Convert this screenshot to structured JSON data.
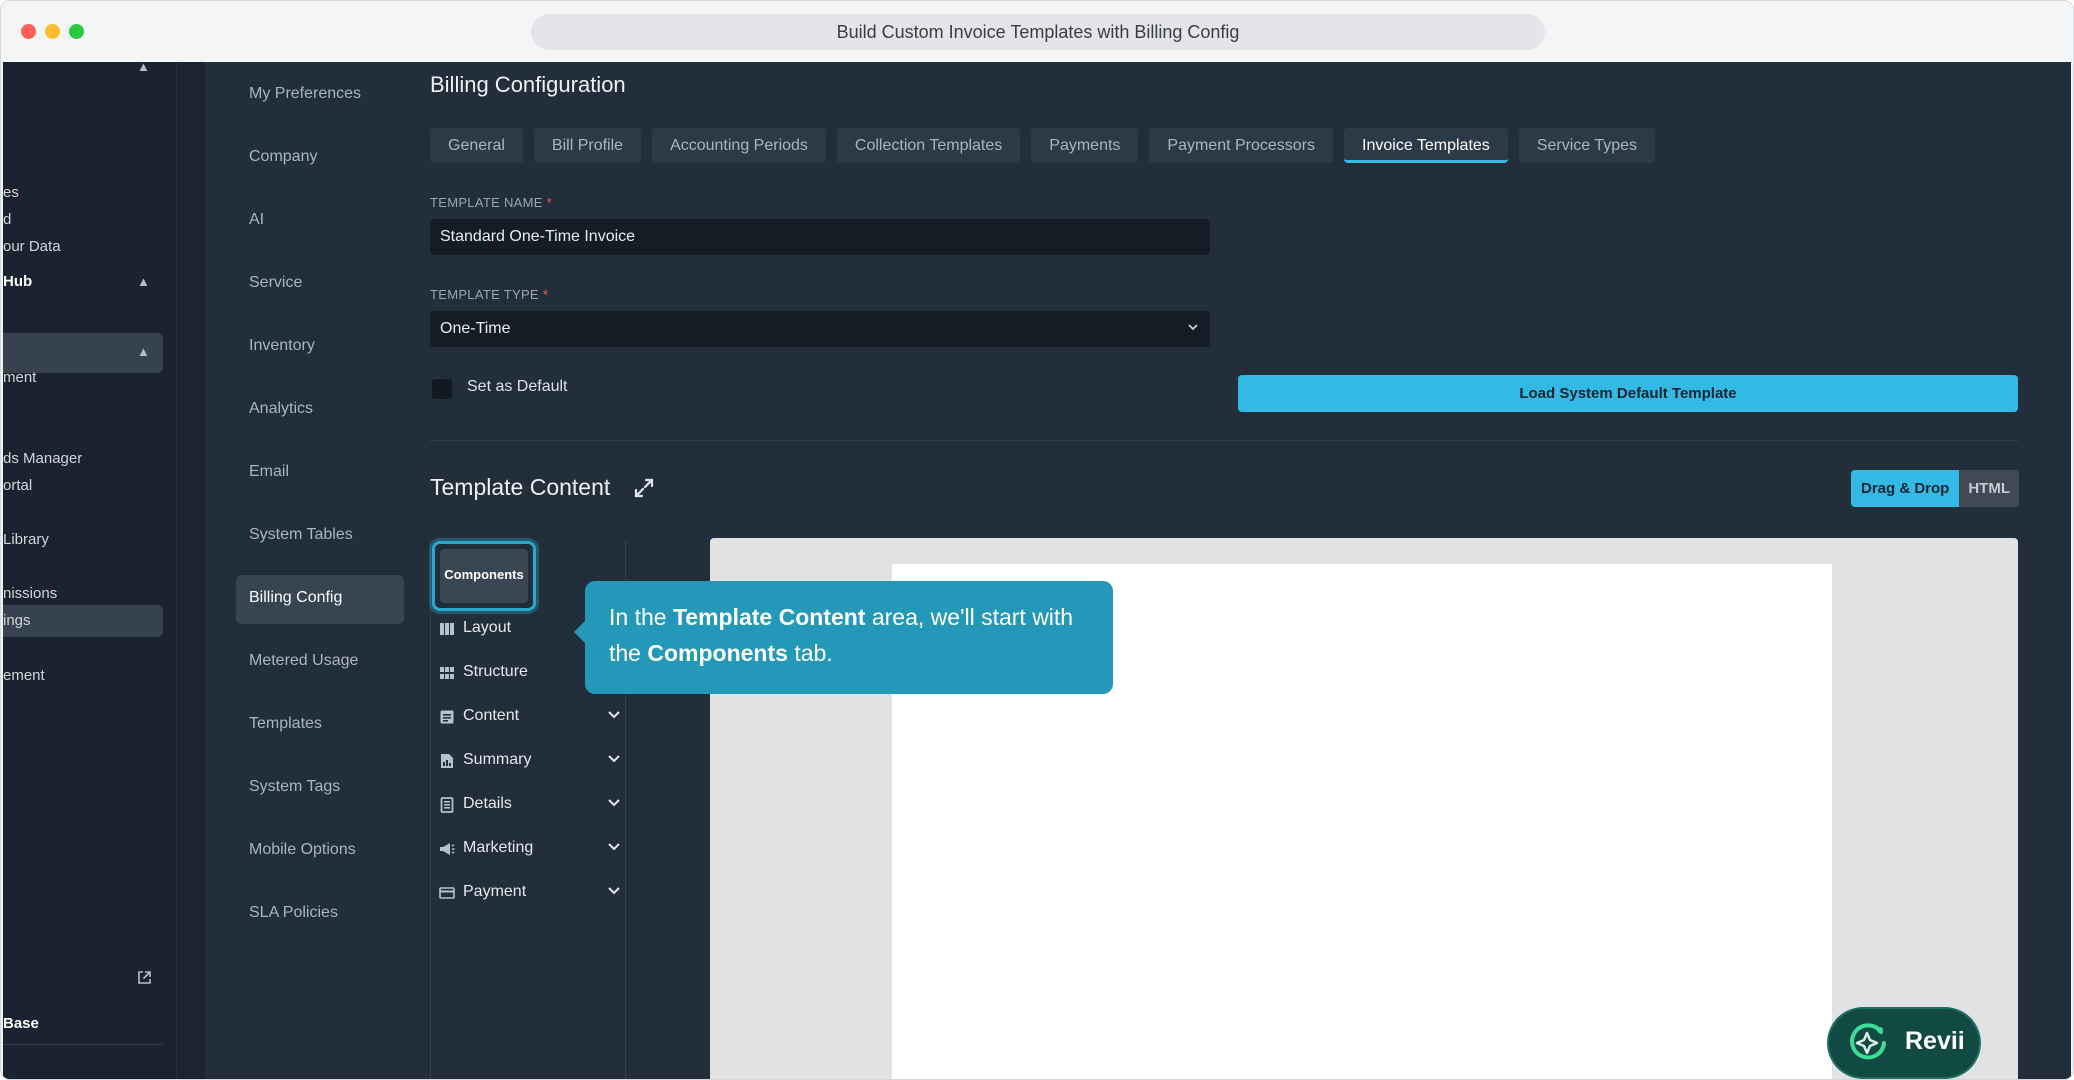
{
  "window": {
    "title": "Build Custom Invoice Templates with Billing Config"
  },
  "nav_primary": {
    "items": [
      {
        "label": "es"
      },
      {
        "label": "d"
      },
      {
        "label": "our Data"
      },
      {
        "label": "Hub"
      },
      {
        "label": "ment"
      },
      {
        "label": "ds Manager"
      },
      {
        "label": "ortal"
      },
      {
        "label": "Library"
      },
      {
        "label": "nissions"
      },
      {
        "label": "ings"
      },
      {
        "label": "ement"
      },
      {
        "label": "Base"
      }
    ]
  },
  "nav_secondary": {
    "items": [
      {
        "label": "My Preferences"
      },
      {
        "label": "Company"
      },
      {
        "label": "AI"
      },
      {
        "label": "Service"
      },
      {
        "label": "Inventory"
      },
      {
        "label": "Analytics"
      },
      {
        "label": "Email"
      },
      {
        "label": "System Tables"
      },
      {
        "label": "Billing Config"
      },
      {
        "label": "Metered Usage"
      },
      {
        "label": "Templates"
      },
      {
        "label": "System Tags"
      },
      {
        "label": "Mobile Options"
      },
      {
        "label": "SLA Policies"
      }
    ],
    "active": "Billing Config"
  },
  "main": {
    "title": "Billing Configuration",
    "tabs": [
      {
        "label": "General"
      },
      {
        "label": "Bill Profile"
      },
      {
        "label": "Accounting Periods"
      },
      {
        "label": "Collection Templates"
      },
      {
        "label": "Payments"
      },
      {
        "label": "Payment Processors"
      },
      {
        "label": "Invoice Templates"
      },
      {
        "label": "Service Types"
      }
    ],
    "active_tab": "Invoice Templates",
    "template_name": {
      "label": "TEMPLATE NAME",
      "required_mark": "*",
      "value": "Standard One-Time Invoice"
    },
    "template_type": {
      "label": "TEMPLATE TYPE",
      "required_mark": "*",
      "value": "One-Time"
    },
    "set_default": {
      "label": "Set as Default",
      "checked": false
    },
    "load_button": "Load System Default Template",
    "content": {
      "title": "Template Content",
      "mode_drag": "Drag & Drop",
      "mode_html": "HTML",
      "active_mode": "Drag & Drop",
      "components_tab": "Components",
      "components": [
        {
          "label": "Layout",
          "icon": "columns-icon"
        },
        {
          "label": "Structure",
          "icon": "grid-icon"
        },
        {
          "label": "Content",
          "icon": "document-icon"
        },
        {
          "label": "Summary",
          "icon": "report-icon"
        },
        {
          "label": "Details",
          "icon": "receipt-icon"
        },
        {
          "label": "Marketing",
          "icon": "megaphone-icon"
        },
        {
          "label": "Payment",
          "icon": "credit-card-icon"
        }
      ]
    }
  },
  "tooltip": {
    "part1": "In the ",
    "bold1": "Template Content",
    "part2": " area, we'll start with the ",
    "bold2": "Components",
    "part3": " tab."
  },
  "assistant": {
    "label": "Revii"
  },
  "colors": {
    "accent": "#32b9e4",
    "tooltip": "#2498b9",
    "assistant": "#114a43"
  }
}
